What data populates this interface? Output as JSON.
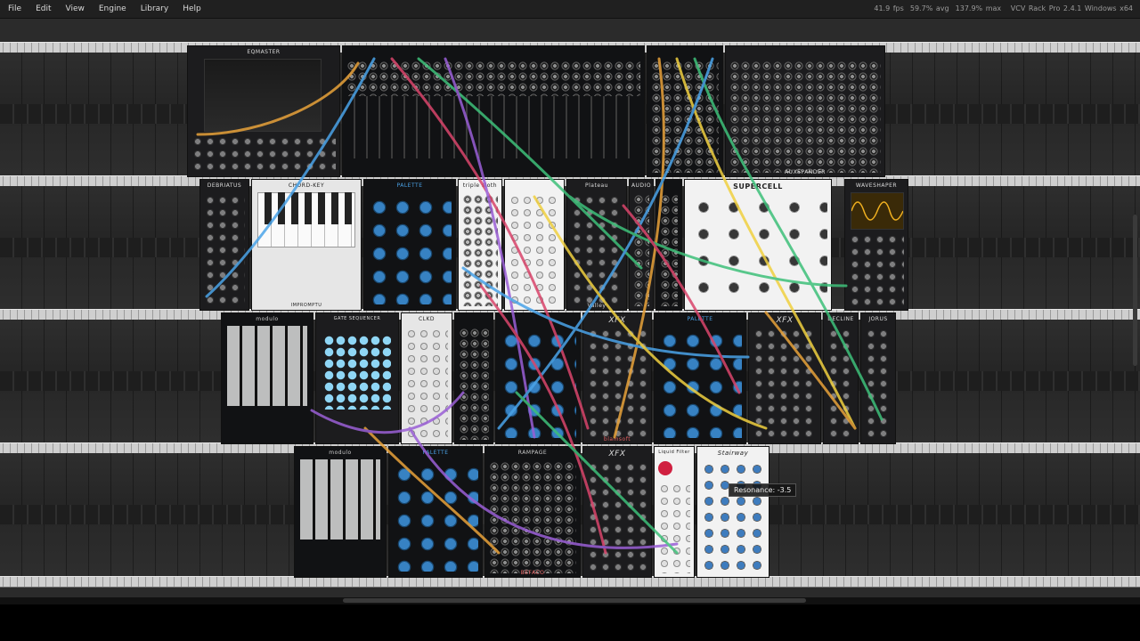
{
  "menu": {
    "items": [
      "File",
      "Edit",
      "View",
      "Engine",
      "Library",
      "Help"
    ]
  },
  "status": {
    "fps": "41.9 fps",
    "avg": "59.7% avg",
    "max": "137.9% max",
    "version": "VCV Rack Pro 2.4.1 Windows x64"
  },
  "modules": {
    "eqmaster": "EQMASTER",
    "auxspander": "AUXSPANDER",
    "debriatus": "DEBRIATUS",
    "chordkey": "CHORD-KEY",
    "palette_1": "PALETTE",
    "triple_sloth": "triple sloth",
    "plateau": "Plateau",
    "audio": "AUDIO",
    "supercell": "SUPERCELL",
    "waveshaper": "WAVESHAPER",
    "modulo_1": "modulo",
    "gate_seq": "GATE SEQUENCER",
    "clkd": "CLKD",
    "xfx_1": "XFX",
    "palette_2": "PALETTE",
    "xfx_2": "XFX",
    "decline": "DECLINE",
    "jorus": "JORUS",
    "modulo_2": "modulo",
    "palette_3": "PALETTE",
    "rampage": "RAMPAGE",
    "xfx_3": "XFX",
    "liquid_filter": "Liquid Filter",
    "stairway": "Stairway",
    "valley": "Valley",
    "impromptu": "IMPROMPTU",
    "blamsoft": "blamsoft",
    "befaco": "BEFACO"
  },
  "tooltip": {
    "text": "Resonance: -3.5"
  },
  "colors": {
    "cable_palette": [
      "#e8a23a",
      "#4aa3e8",
      "#3ec07a",
      "#d9456b",
      "#9a5fd6",
      "#f0d040"
    ]
  }
}
